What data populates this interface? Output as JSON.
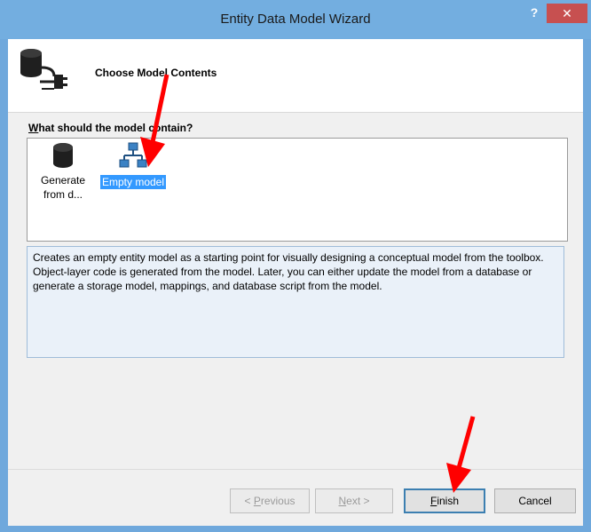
{
  "window": {
    "title": "Entity Data Model Wizard",
    "help_label": "?",
    "close_label": "✕"
  },
  "header": {
    "title": "Choose Model Contents",
    "icon": "database-connection-icon"
  },
  "question": {
    "prefix": "W",
    "rest": "hat should the model contain?"
  },
  "model_options": [
    {
      "label_line1": "Generate",
      "label_line2": "from d...",
      "icon": "database-icon",
      "selected": false
    },
    {
      "label": "Empty model",
      "icon": "entity-model-icon",
      "selected": true
    }
  ],
  "description": "Creates an empty entity model as a starting point for visually designing a conceptual model from the toolbox. Object-layer code is generated from the model. Later, you can either update the model from a database or generate a storage model, mappings, and database script from the model.",
  "buttons": {
    "previous": {
      "before": "< ",
      "key": "P",
      "after": "revious",
      "enabled": false
    },
    "next": {
      "key": "N",
      "after": "ext >",
      "enabled": false
    },
    "finish": {
      "key": "F",
      "after": "inish",
      "enabled": true
    },
    "cancel": {
      "label": "Cancel",
      "enabled": true
    }
  },
  "colors": {
    "title_bar": "#73aee0",
    "close_button": "#c75050",
    "selection": "#3399ff",
    "annotation_arrow": "#ff0000"
  }
}
